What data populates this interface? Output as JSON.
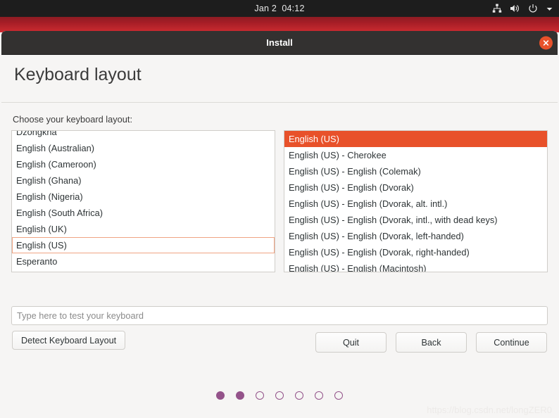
{
  "topbar": {
    "clock": "Jan 2  04:12",
    "icons": [
      "network-icon",
      "volume-icon",
      "power-icon",
      "chevron-down-icon"
    ]
  },
  "window": {
    "title": "Install",
    "close_icon": "close-icon"
  },
  "page": {
    "heading": "Keyboard layout",
    "choose_label": "Choose your keyboard layout:"
  },
  "left_list": {
    "items": [
      "Dzongkha",
      "English (Australian)",
      "English (Cameroon)",
      "English (Ghana)",
      "English (Nigeria)",
      "English (South Africa)",
      "English (UK)",
      "English (US)",
      "Esperanto"
    ],
    "focused_index": 7
  },
  "right_list": {
    "items": [
      "English (US)",
      "English (US) - Cherokee",
      "English (US) - English (Colemak)",
      "English (US) - English (Dvorak)",
      "English (US) - English (Dvorak, alt. intl.)",
      "English (US) - English (Dvorak, intl., with dead keys)",
      "English (US) - English (Dvorak, left-handed)",
      "English (US) - English (Dvorak, right-handed)",
      "English (US) - English (Macintosh)"
    ],
    "selected_index": 0
  },
  "test_field": {
    "placeholder": "Type here to test your keyboard",
    "value": ""
  },
  "detect_button": "Detect Keyboard Layout",
  "nav_buttons": [
    "Quit",
    "Back",
    "Continue"
  ],
  "progress": {
    "total": 7,
    "filled": 2
  },
  "watermark": "https://blog.csdn.net/longZER0",
  "colors": {
    "accent_orange": "#e8512a",
    "focus_ring": "#f0a483",
    "dot_purple": "#94538a",
    "titlebar": "#333130",
    "topbar": "#1d1d1d",
    "background": "#f6f5f4"
  }
}
